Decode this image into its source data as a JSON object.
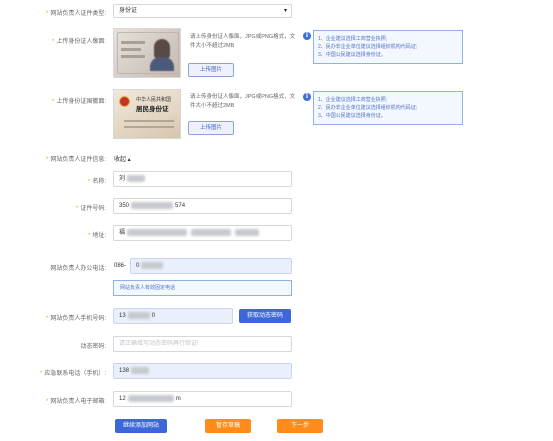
{
  "id_type": {
    "label": "网站负责人证件类型:",
    "value": "身份证",
    "chevron": "▾"
  },
  "id_front": {
    "label": "上传身份证人像面:",
    "hint_line1": "请上传身份证人像面，JPG或PNG格式，文",
    "hint_line2": "件大小不超过2MB",
    "upload_label": "上传图片"
  },
  "id_back": {
    "label": "上传身份证国徽面:",
    "hint_line1": "请上传身份证人像面，JPG或PNG格式，文",
    "hint_line2": "件大小不超过2MB",
    "upload_label": "上传图片",
    "card_line1": "中华人民共和国",
    "card_line2": "居民身份证"
  },
  "tips": {
    "icon_glyph": "i",
    "items": [
      "1、企业建议选择工商营业执照;",
      "2、民办非企业单位建议选择组织机构代码证;",
      "3、中国公民建议选择身份证。"
    ]
  },
  "cert_info": {
    "label": "网站负责人证件信息:",
    "toggle": "收起 ▴"
  },
  "name": {
    "label": "名称:",
    "value": "刘"
  },
  "cert_no": {
    "label": "证件号码:",
    "prefix": "350",
    "suffix": "574"
  },
  "address": {
    "label": "地址:",
    "value": "福"
  },
  "office_phone": {
    "label": "网站负责人办公电话:",
    "area_code": "086-",
    "value": "0",
    "hint": "网站负责人有效固定电话"
  },
  "mobile": {
    "label": "网站负责人手机号码:",
    "prefix": "13",
    "suffix": "0",
    "code_button": "获取动态密码"
  },
  "dynamic_code": {
    "label": "动态密码:",
    "placeholder": "请正确填写动态密码再行验证!"
  },
  "emergency": {
    "label": "应急联系电话（手机）:",
    "value": "138"
  },
  "email": {
    "label": "网站负责人电子邮箱:",
    "prefix": "12",
    "suffix": "m"
  },
  "buttons": {
    "add_site": "继续添加网站",
    "save_draft": "暂存草稿",
    "next": "下一步"
  },
  "colors": {
    "primary": "#3d66d9",
    "accent": "#ff8c1a",
    "required": "#f0a030"
  }
}
